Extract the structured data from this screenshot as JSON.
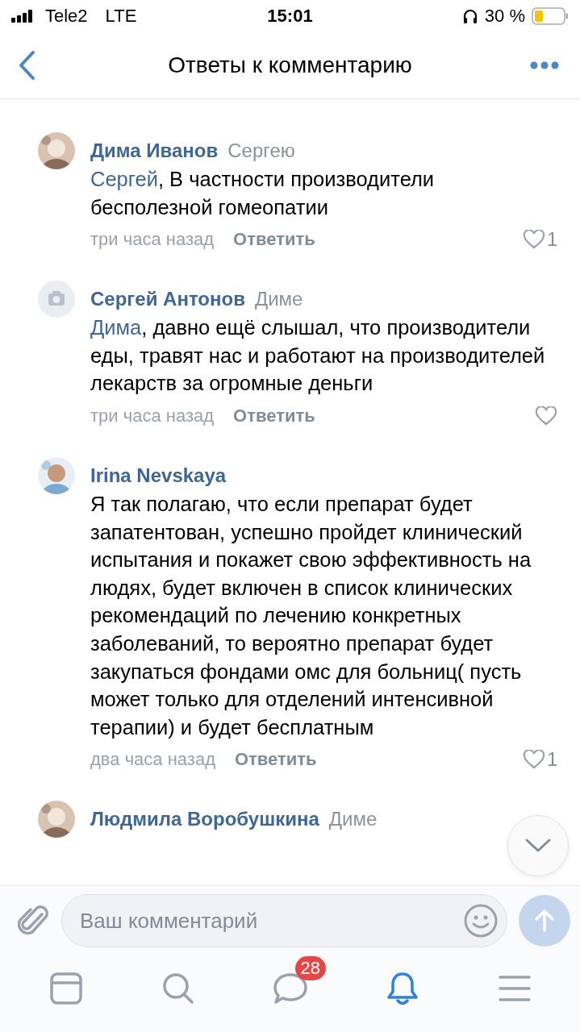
{
  "status_bar": {
    "carrier": "Tele2",
    "network": "LTE",
    "time": "15:01",
    "battery_text": "30 %"
  },
  "header": {
    "title": "Ответы к комментарию"
  },
  "comments": [
    {
      "author": "Дима Иванов",
      "addressee": "Сергею",
      "mention": "Сергей",
      "text": ", В частности производители бесполезной гомеопатии",
      "time": "три часа назад",
      "reply": "Ответить",
      "liked": false,
      "likes": "1"
    },
    {
      "kind": "no_photo",
      "author": "Сергей Антонов",
      "addressee": "Диме",
      "mention": "Дима",
      "text": ", давно ещё слышал, что производители еды, травят нас и работают на производителей лекарств за огромные деньги",
      "time": "три часа назад",
      "reply": "Ответить",
      "liked": false
    },
    {
      "author": "Irina Nevskaya",
      "text": "Я так полагаю, что если препарат будет запатентован, успешно пройдет клинический испытания и покажет свою эффективность на людях, будет включен в список клинических рекомендаций по лечению конкретных заболеваний, то вероятно препарат будет закупаться фондами омс для больниц( пусть может только для отделений интенсивной терапии) и будет бесплатным",
      "time": "два часа назад",
      "reply": "Ответить",
      "liked": false,
      "likes": "1"
    },
    {
      "author": "Людмила Воробушкина",
      "addressee": "Диме"
    }
  ],
  "composer": {
    "placeholder": "Ваш комментарий"
  },
  "tabs": [
    {
      "kind": "feed",
      "selected": false
    },
    {
      "kind": "search",
      "selected": false
    },
    {
      "kind": "messages",
      "selected": false,
      "badge": "28"
    },
    {
      "kind": "notifications",
      "selected": true
    },
    {
      "kind": "menu",
      "selected": false
    }
  ]
}
